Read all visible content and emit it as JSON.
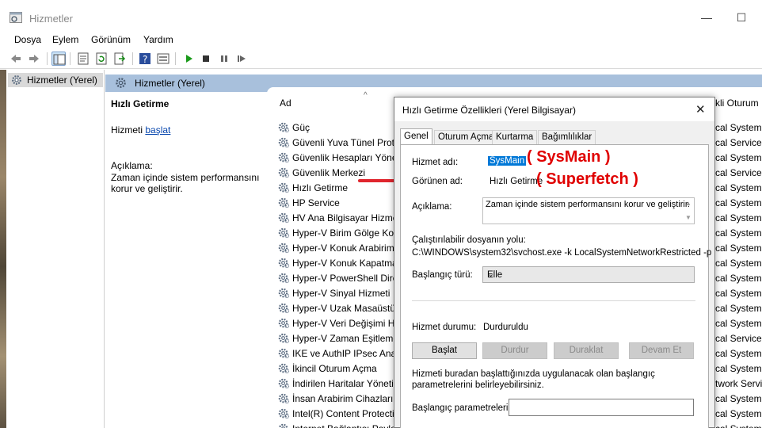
{
  "window": {
    "title": "Hizmetler"
  },
  "menu": [
    "Dosya",
    "Eylem",
    "Görünüm",
    "Yardım"
  ],
  "toolbar_icons": [
    "back-arrow-icon",
    "forward-arrow-icon",
    "show-tree-icon",
    "properties-icon",
    "refresh-icon",
    "export-list-icon",
    "help-icon",
    "console-icon",
    "play-icon",
    "stop-icon",
    "pause-icon",
    "restart-icon"
  ],
  "tree": {
    "item": "Hizmetler (Yerel)"
  },
  "main": {
    "header": "Hizmetler (Yerel)",
    "selected_service": "Hızlı Getirme",
    "start_prefix": "Hizmeti",
    "start_link": "başlat",
    "description_label": "Açıklama:",
    "description_text": "Zaman içinde sistem performansını korur ve geliştirir."
  },
  "list": {
    "col_name": "Ad",
    "col_logon": "kli Oturum",
    "rows": [
      {
        "name": "Güç",
        "logon": "cal System"
      },
      {
        "name": "Güvenli Yuva Tünel Prot",
        "logon": "cal Service"
      },
      {
        "name": "Güvenlik Hesapları Yöne",
        "logon": "cal System"
      },
      {
        "name": "Güvenlik Merkezi",
        "logon": "cal Service"
      },
      {
        "name": "Hızlı Getirme",
        "logon": "cal System"
      },
      {
        "name": "HP Service",
        "logon": "cal System"
      },
      {
        "name": "HV Ana Bilgisayar Hizme",
        "logon": "cal System"
      },
      {
        "name": "Hyper-V Birim Gölge Ko",
        "logon": "cal System"
      },
      {
        "name": "Hyper-V Konuk Arabirim",
        "logon": "cal System"
      },
      {
        "name": "Hyper-V Konuk Kapatma",
        "logon": "cal System"
      },
      {
        "name": "Hyper-V PowerShell Dire",
        "logon": "cal System"
      },
      {
        "name": "Hyper-V Sinyal Hizmeti",
        "logon": "cal System"
      },
      {
        "name": "Hyper-V Uzak Masaüstü",
        "logon": "cal System"
      },
      {
        "name": "Hyper-V Veri Değişimi H",
        "logon": "cal System"
      },
      {
        "name": "Hyper-V Zaman Eşitleme",
        "logon": "cal Service"
      },
      {
        "name": "IKE ve AuthIP IPsec Anah",
        "logon": "cal System"
      },
      {
        "name": "İkincil Oturum Açma",
        "logon": "cal System"
      },
      {
        "name": "İndirilen Haritalar Yöneti",
        "logon": "twork Service"
      },
      {
        "name": "İnsan Arabirim Cihazları",
        "logon": "cal System"
      },
      {
        "name": "Intel(R) Content Protecti",
        "logon": "cal System"
      },
      {
        "name": "Internet Bağlantısı Payla",
        "logon": "cal System"
      }
    ]
  },
  "dialog": {
    "title": "Hızlı Getirme Özellikleri (Yerel Bilgisayar)",
    "tabs": [
      "Genel",
      "Oturum Açma",
      "Kurtarma",
      "Bağımlılıklar"
    ],
    "service_name_label": "Hizmet adı:",
    "service_name": "SysMain",
    "display_name_label": "Görünen ad:",
    "display_name": "Hızlı Getirme",
    "description_label": "Açıklama:",
    "description": "Zaman içinde sistem performansını korur ve geliştirir.",
    "path_label": "Çalıştırılabilir dosyanın yolu:",
    "path": "C:\\WINDOWS\\system32\\svchost.exe -k LocalSystemNetworkRestricted -p",
    "startup_type_label": "Başlangıç türü:",
    "startup_type": "Elle",
    "status_label": "Hizmet durumu:",
    "status": "Durduruldu",
    "buttons": [
      "Başlat",
      "Durdur",
      "Duraklat",
      "Devam Et"
    ],
    "params_hint": "Hizmeti buradan başlattığınızda uygulanacak olan başlangıç parametrelerini belirleyebilirsiniz.",
    "params_label": "Başlangıç parametreleri:"
  },
  "annotations": {
    "sysmain": "( SysMain )",
    "superfetch": "( Superfetch )",
    "color": "#e00000"
  }
}
